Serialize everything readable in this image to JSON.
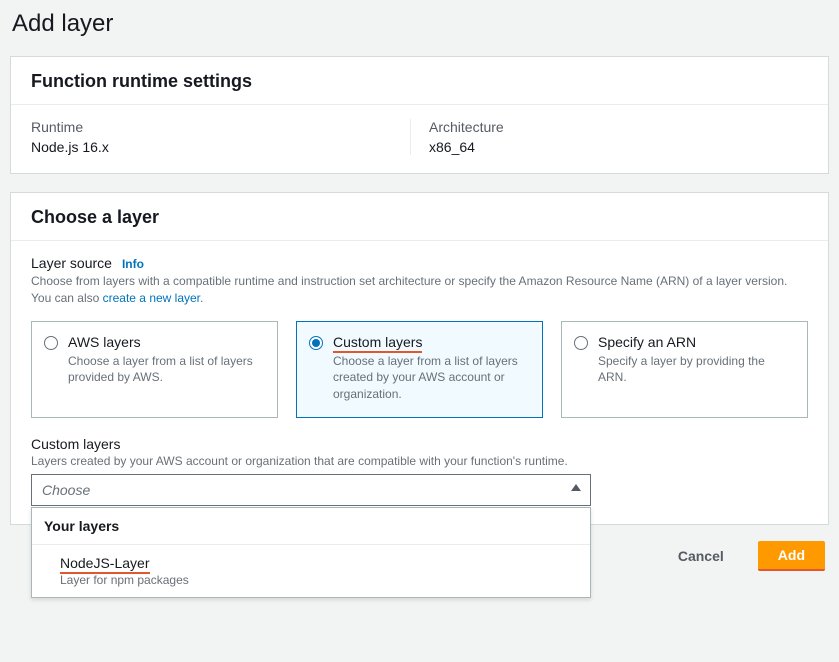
{
  "page_title": "Add layer",
  "runtime_panel": {
    "header": "Function runtime settings",
    "runtime_label": "Runtime",
    "runtime_value": "Node.js 16.x",
    "arch_label": "Architecture",
    "arch_value": "x86_64"
  },
  "choose_panel": {
    "header": "Choose a layer",
    "source_label": "Layer source",
    "info_text": "Info",
    "source_help_prefix": "Choose from layers with a compatible runtime and instruction set architecture or specify the Amazon Resource Name (ARN) of a layer version. You can also ",
    "source_help_link": "create a new layer",
    "tiles": {
      "aws": {
        "title": "AWS layers",
        "desc": "Choose a layer from a list of layers provided by AWS."
      },
      "custom": {
        "title": "Custom layers",
        "desc": "Choose a layer from a list of layers created by your AWS account or organization."
      },
      "arn": {
        "title": "Specify an ARN",
        "desc": "Specify a layer by providing the ARN."
      }
    },
    "custom_label": "Custom layers",
    "custom_help": "Layers created by your AWS account or organization that are compatible with your function's runtime.",
    "select_placeholder": "Choose",
    "dropdown_group": "Your layers",
    "dropdown_item_title": "NodeJS-Layer",
    "dropdown_item_desc": "Layer for npm packages"
  },
  "actions": {
    "cancel": "Cancel",
    "add": "Add"
  }
}
